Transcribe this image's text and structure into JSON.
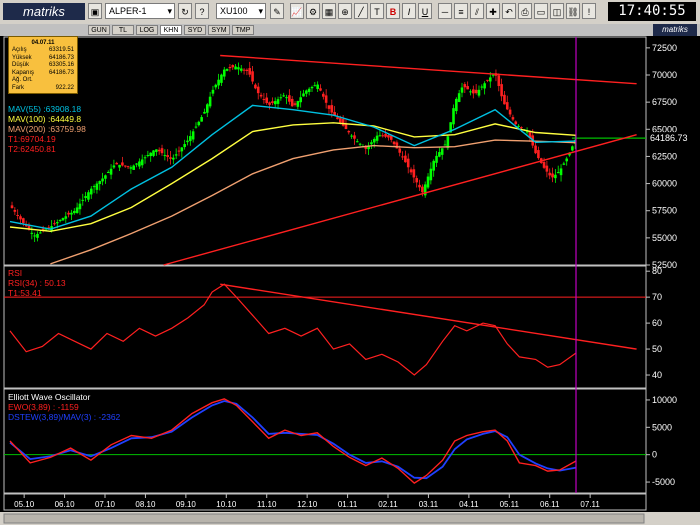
{
  "toolbar": {
    "logo": "matriks",
    "layout_select": "ALPER-1",
    "symbol_select": "XU100",
    "clock": "17:40:55",
    "buttons": [
      "B",
      "I",
      "U"
    ]
  },
  "tabs": [
    "GUN",
    "TL",
    "LOG",
    "KHN",
    "SYD",
    "SYM",
    "TMP"
  ],
  "active_tab": "KHN",
  "watermark": "matriks",
  "infobox": {
    "date": "04.07.11",
    "rows": [
      {
        "label": "Açılış",
        "value": "63319.51"
      },
      {
        "label": "Yüksek",
        "value": "64186.73"
      },
      {
        "label": "Düşük",
        "value": "63305.16"
      },
      {
        "label": "Kapanış",
        "value": "64186.73"
      },
      {
        "label": "Ağ. Ort.",
        "value": ""
      },
      {
        "label": "Fark",
        "value": "922.22"
      }
    ]
  },
  "colors": {
    "mav55": "#00c0e0",
    "mav100": "#ffff40",
    "mav200": "#f0a070",
    "trend": "#ff2020",
    "up": "#00ff00",
    "down": "#ff2020",
    "rsi": "#ff2020",
    "ewo": "#ff2020",
    "ewo_sig": "#2040ff",
    "level": "#00c000",
    "cursor": "#c000c0"
  },
  "chart_data": [
    {
      "type": "line",
      "title": "XU100",
      "ylim": [
        52500,
        73500
      ],
      "yticks": [
        52500,
        55000,
        57500,
        60000,
        62500,
        65000,
        67500,
        70000,
        72500
      ],
      "last_value_label": "64186.73",
      "indicators": [
        {
          "label": "MAV(55)",
          "value": "63908.18",
          "color": "#00c0e0"
        },
        {
          "label": "MAV(100)",
          "value": "64449.8",
          "color": "#ffff40"
        },
        {
          "label": "MAV(200)",
          "value": "63759.98",
          "color": "#f0a070"
        },
        {
          "label": "T1",
          "value": "69704.19",
          "color": "#ff2020"
        },
        {
          "label": "T2",
          "value": "62450.81",
          "color": "#ff2020"
        }
      ],
      "x_axis": [
        "05.10",
        "06.10",
        "07.10",
        "08.10",
        "09.10",
        "10.10",
        "11.10",
        "12.10",
        "01.11",
        "02.11",
        "03.11",
        "04.11",
        "05.11",
        "06.11",
        "07.11"
      ],
      "close_series": [
        [
          0,
          58000
        ],
        [
          0.3,
          56500
        ],
        [
          0.6,
          55200
        ],
        [
          1.0,
          56000
        ],
        [
          1.3,
          56800
        ],
        [
          1.6,
          57500
        ],
        [
          2.0,
          59500
        ],
        [
          2.3,
          60500
        ],
        [
          2.6,
          61800
        ],
        [
          3.0,
          61500
        ],
        [
          3.3,
          62300
        ],
        [
          3.6,
          63200
        ],
        [
          4.0,
          62200
        ],
        [
          4.4,
          64000
        ],
        [
          4.8,
          66500
        ],
        [
          5.0,
          68500
        ],
        [
          5.3,
          70500
        ],
        [
          5.6,
          70800
        ],
        [
          5.9,
          70300
        ],
        [
          6.1,
          68500
        ],
        [
          6.4,
          67200
        ],
        [
          6.8,
          68200
        ],
        [
          7.0,
          67000
        ],
        [
          7.3,
          68500
        ],
        [
          7.6,
          69200
        ],
        [
          7.9,
          66800
        ],
        [
          8.2,
          65500
        ],
        [
          8.5,
          64200
        ],
        [
          8.8,
          63200
        ],
        [
          9.1,
          64500
        ],
        [
          9.4,
          64200
        ],
        [
          9.7,
          62500
        ],
        [
          10.0,
          60500
        ],
        [
          10.2,
          59200
        ],
        [
          10.5,
          62300
        ],
        [
          10.8,
          63800
        ],
        [
          11.0,
          67500
        ],
        [
          11.2,
          69000
        ],
        [
          11.5,
          68200
        ],
        [
          11.8,
          69500
        ],
        [
          12.0,
          70200
        ],
        [
          12.2,
          67500
        ],
        [
          12.5,
          65500
        ],
        [
          12.8,
          64800
        ],
        [
          13.0,
          62800
        ],
        [
          13.2,
          61500
        ],
        [
          13.4,
          60500
        ],
        [
          13.6,
          61200
        ],
        [
          13.8,
          62500
        ],
        [
          14.0,
          64186.73
        ]
      ],
      "mav55": [
        [
          0,
          56500
        ],
        [
          1,
          55800
        ],
        [
          2,
          57000
        ],
        [
          3,
          59500
        ],
        [
          4,
          61500
        ],
        [
          5,
          64500
        ],
        [
          6,
          67200
        ],
        [
          7,
          66800
        ],
        [
          8,
          66300
        ],
        [
          9,
          65200
        ],
        [
          10,
          63500
        ],
        [
          11,
          65000
        ],
        [
          12,
          66800
        ],
        [
          13,
          63800
        ],
        [
          14,
          63908
        ]
      ],
      "mav100": [
        [
          0,
          56000
        ],
        [
          1,
          55600
        ],
        [
          2,
          56300
        ],
        [
          3,
          57800
        ],
        [
          4,
          60000
        ],
        [
          5,
          62300
        ],
        [
          6,
          64800
        ],
        [
          7,
          65400
        ],
        [
          8,
          65600
        ],
        [
          9,
          65300
        ],
        [
          10,
          64300
        ],
        [
          11,
          64500
        ],
        [
          12,
          65500
        ],
        [
          13,
          64700
        ],
        [
          14,
          64450
        ]
      ],
      "mav200": [
        [
          1,
          52600
        ],
        [
          2,
          53900
        ],
        [
          3,
          55400
        ],
        [
          4,
          57000
        ],
        [
          5,
          58900
        ],
        [
          6,
          60900
        ],
        [
          7,
          62300
        ],
        [
          8,
          63100
        ],
        [
          9,
          63500
        ],
        [
          10,
          63300
        ],
        [
          11,
          63400
        ],
        [
          12,
          64000
        ],
        [
          13,
          63900
        ],
        [
          14,
          63760
        ]
      ],
      "trend_top": [
        [
          5.2,
          71800
        ],
        [
          15.5,
          69200
        ]
      ],
      "trend_bottom": [
        [
          3.8,
          52500
        ],
        [
          15.5,
          64500
        ]
      ],
      "level_line": 64186.73
    },
    {
      "type": "line",
      "title": "RSI",
      "label": "RSI(34)",
      "value": "50.13",
      "t1_label": "T1",
      "t1_value": "53.41",
      "ylim": [
        35,
        82
      ],
      "yticks": [
        40,
        50,
        60,
        70,
        80
      ],
      "level": 70,
      "series": [
        [
          0,
          57
        ],
        [
          0.4,
          49
        ],
        [
          0.8,
          51
        ],
        [
          1.2,
          56
        ],
        [
          1.6,
          53
        ],
        [
          2,
          50
        ],
        [
          2.4,
          56
        ],
        [
          2.8,
          53
        ],
        [
          3.2,
          58
        ],
        [
          3.6,
          55
        ],
        [
          4,
          58
        ],
        [
          4.4,
          62
        ],
        [
          4.8,
          67
        ],
        [
          5.0,
          72
        ],
        [
          5.3,
          75
        ],
        [
          5.6,
          70
        ],
        [
          6,
          63
        ],
        [
          6.4,
          56
        ],
        [
          6.8,
          58
        ],
        [
          7.2,
          55
        ],
        [
          7.6,
          58
        ],
        [
          8,
          50
        ],
        [
          8.4,
          52
        ],
        [
          8.8,
          46
        ],
        [
          9.2,
          48
        ],
        [
          9.6,
          45
        ],
        [
          10,
          40
        ],
        [
          10.3,
          44
        ],
        [
          10.7,
          53
        ],
        [
          11.0,
          59
        ],
        [
          11.3,
          57
        ],
        [
          11.7,
          60
        ],
        [
          12.0,
          59
        ],
        [
          12.3,
          52
        ],
        [
          12.6,
          47
        ],
        [
          13.0,
          46
        ],
        [
          13.3,
          43
        ],
        [
          13.6,
          44
        ],
        [
          14,
          48.5
        ]
      ],
      "trend": [
        [
          5.2,
          75
        ],
        [
          15.5,
          50
        ]
      ]
    },
    {
      "type": "line",
      "title": "Elliott Wave Oscillator",
      "label": "EWO(3,89)",
      "value": "-1159",
      "signal_label": "DSTEW(3,89)/MAV(3)",
      "signal_value": "-2362",
      "ylim": [
        -7000,
        12000
      ],
      "yticks": [
        -5000,
        0,
        5000,
        10000
      ],
      "level": 0,
      "series": [
        [
          0,
          2500
        ],
        [
          0.5,
          -1500
        ],
        [
          1,
          -500
        ],
        [
          1.5,
          1200
        ],
        [
          2,
          -1000
        ],
        [
          2.5,
          1800
        ],
        [
          3,
          3500
        ],
        [
          3.5,
          3000
        ],
        [
          4,
          4500
        ],
        [
          4.5,
          7500
        ],
        [
          5,
          9500
        ],
        [
          5.3,
          10200
        ],
        [
          5.6,
          9000
        ],
        [
          6,
          6000
        ],
        [
          6.4,
          3000
        ],
        [
          6.8,
          4500
        ],
        [
          7.2,
          3500
        ],
        [
          7.6,
          4000
        ],
        [
          8,
          1500
        ],
        [
          8.4,
          -500
        ],
        [
          8.8,
          -2000
        ],
        [
          9.2,
          -600
        ],
        [
          9.6,
          -2500
        ],
        [
          10,
          -5200
        ],
        [
          10.3,
          -3800
        ],
        [
          10.7,
          -1000
        ],
        [
          11,
          2500
        ],
        [
          11.3,
          3500
        ],
        [
          11.7,
          4200
        ],
        [
          12,
          4500
        ],
        [
          12.3,
          2500
        ],
        [
          12.6,
          -1500
        ],
        [
          13,
          -2000
        ],
        [
          13.3,
          -3000
        ],
        [
          13.6,
          -2800
        ],
        [
          14,
          -1159
        ]
      ],
      "signal": [
        [
          0,
          2200
        ],
        [
          0.5,
          -800
        ],
        [
          1,
          -300
        ],
        [
          1.5,
          800
        ],
        [
          2,
          -300
        ],
        [
          2.5,
          1200
        ],
        [
          3,
          3000
        ],
        [
          3.5,
          3200
        ],
        [
          4,
          4200
        ],
        [
          4.5,
          6800
        ],
        [
          5,
          9000
        ],
        [
          5.3,
          9800
        ],
        [
          5.6,
          9300
        ],
        [
          6,
          6800
        ],
        [
          6.4,
          3800
        ],
        [
          6.8,
          4000
        ],
        [
          7.2,
          3800
        ],
        [
          7.6,
          3600
        ],
        [
          8,
          2000
        ],
        [
          8.4,
          0
        ],
        [
          8.8,
          -1500
        ],
        [
          9.2,
          -1200
        ],
        [
          9.6,
          -2200
        ],
        [
          10,
          -4200
        ],
        [
          10.3,
          -4300
        ],
        [
          10.7,
          -2200
        ],
        [
          11,
          1000
        ],
        [
          11.3,
          2800
        ],
        [
          11.7,
          3800
        ],
        [
          12,
          4300
        ],
        [
          12.3,
          3200
        ],
        [
          12.6,
          0
        ],
        [
          13,
          -1600
        ],
        [
          13.3,
          -2500
        ],
        [
          13.6,
          -2900
        ],
        [
          14,
          -2362
        ]
      ]
    }
  ]
}
